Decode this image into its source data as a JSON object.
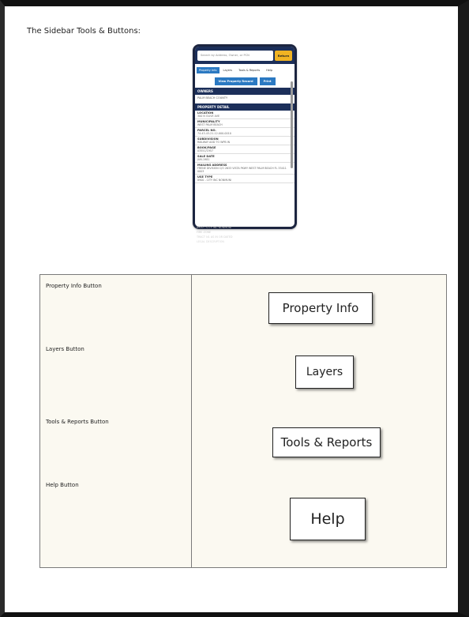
{
  "doc": {
    "title": "The Sidebar Tools & Buttons:"
  },
  "sidebar_shot": {
    "search_placeholder": "Search by Address, Owner, or PCN",
    "return_label": "Return",
    "tabs": [
      "Property Info",
      "Layers",
      "Tools & Reports",
      "Help"
    ],
    "buttons": [
      "View Property Record",
      "Print"
    ],
    "owners_heading": "OWNERS",
    "owner_value": "PALM BEACH COUNTY",
    "detail_heading": "PROPERTY DETAIL",
    "fields": [
      {
        "label": "LOCATION",
        "value": "300 N OLIVE AVE"
      },
      {
        "label": "MUNICIPALITY",
        "value": "WEST PALM BEACH"
      },
      {
        "label": "PARCEL NO.",
        "value": "74-43-43-21-12-000-0010"
      },
      {
        "label": "SUBDIVISION",
        "value": "RAILWAY ADD TO WPB IN"
      },
      {
        "label": "BOOK/PAGE",
        "value": "03551/1957"
      },
      {
        "label": "SALE DATE",
        "value": "JUN-1981"
      },
      {
        "label": "MAILING ADDRESS",
        "value": "FRENE DIVISION C/O 2633 VISTA PKWY WEST PALM BEACH FL 33411 0003"
      },
      {
        "label": "USE TYPE",
        "value": "8900 - CITY INC NONMUNI"
      }
    ],
    "faded_lines": [
      "8900 - CITY INC NONMUNI",
      "FIRE ZONE",
      "TRACT N1 AS IN OR DATED",
      "LEGAL DESCRIPTION"
    ]
  },
  "table": {
    "rows": [
      {
        "label": "Property Info Button",
        "button": "Property Info"
      },
      {
        "label": "Layers Button",
        "button": "Layers"
      },
      {
        "label": "Tools & Reports Button",
        "button": "Tools & Reports"
      },
      {
        "label": "Help Button",
        "button": "Help"
      }
    ]
  }
}
